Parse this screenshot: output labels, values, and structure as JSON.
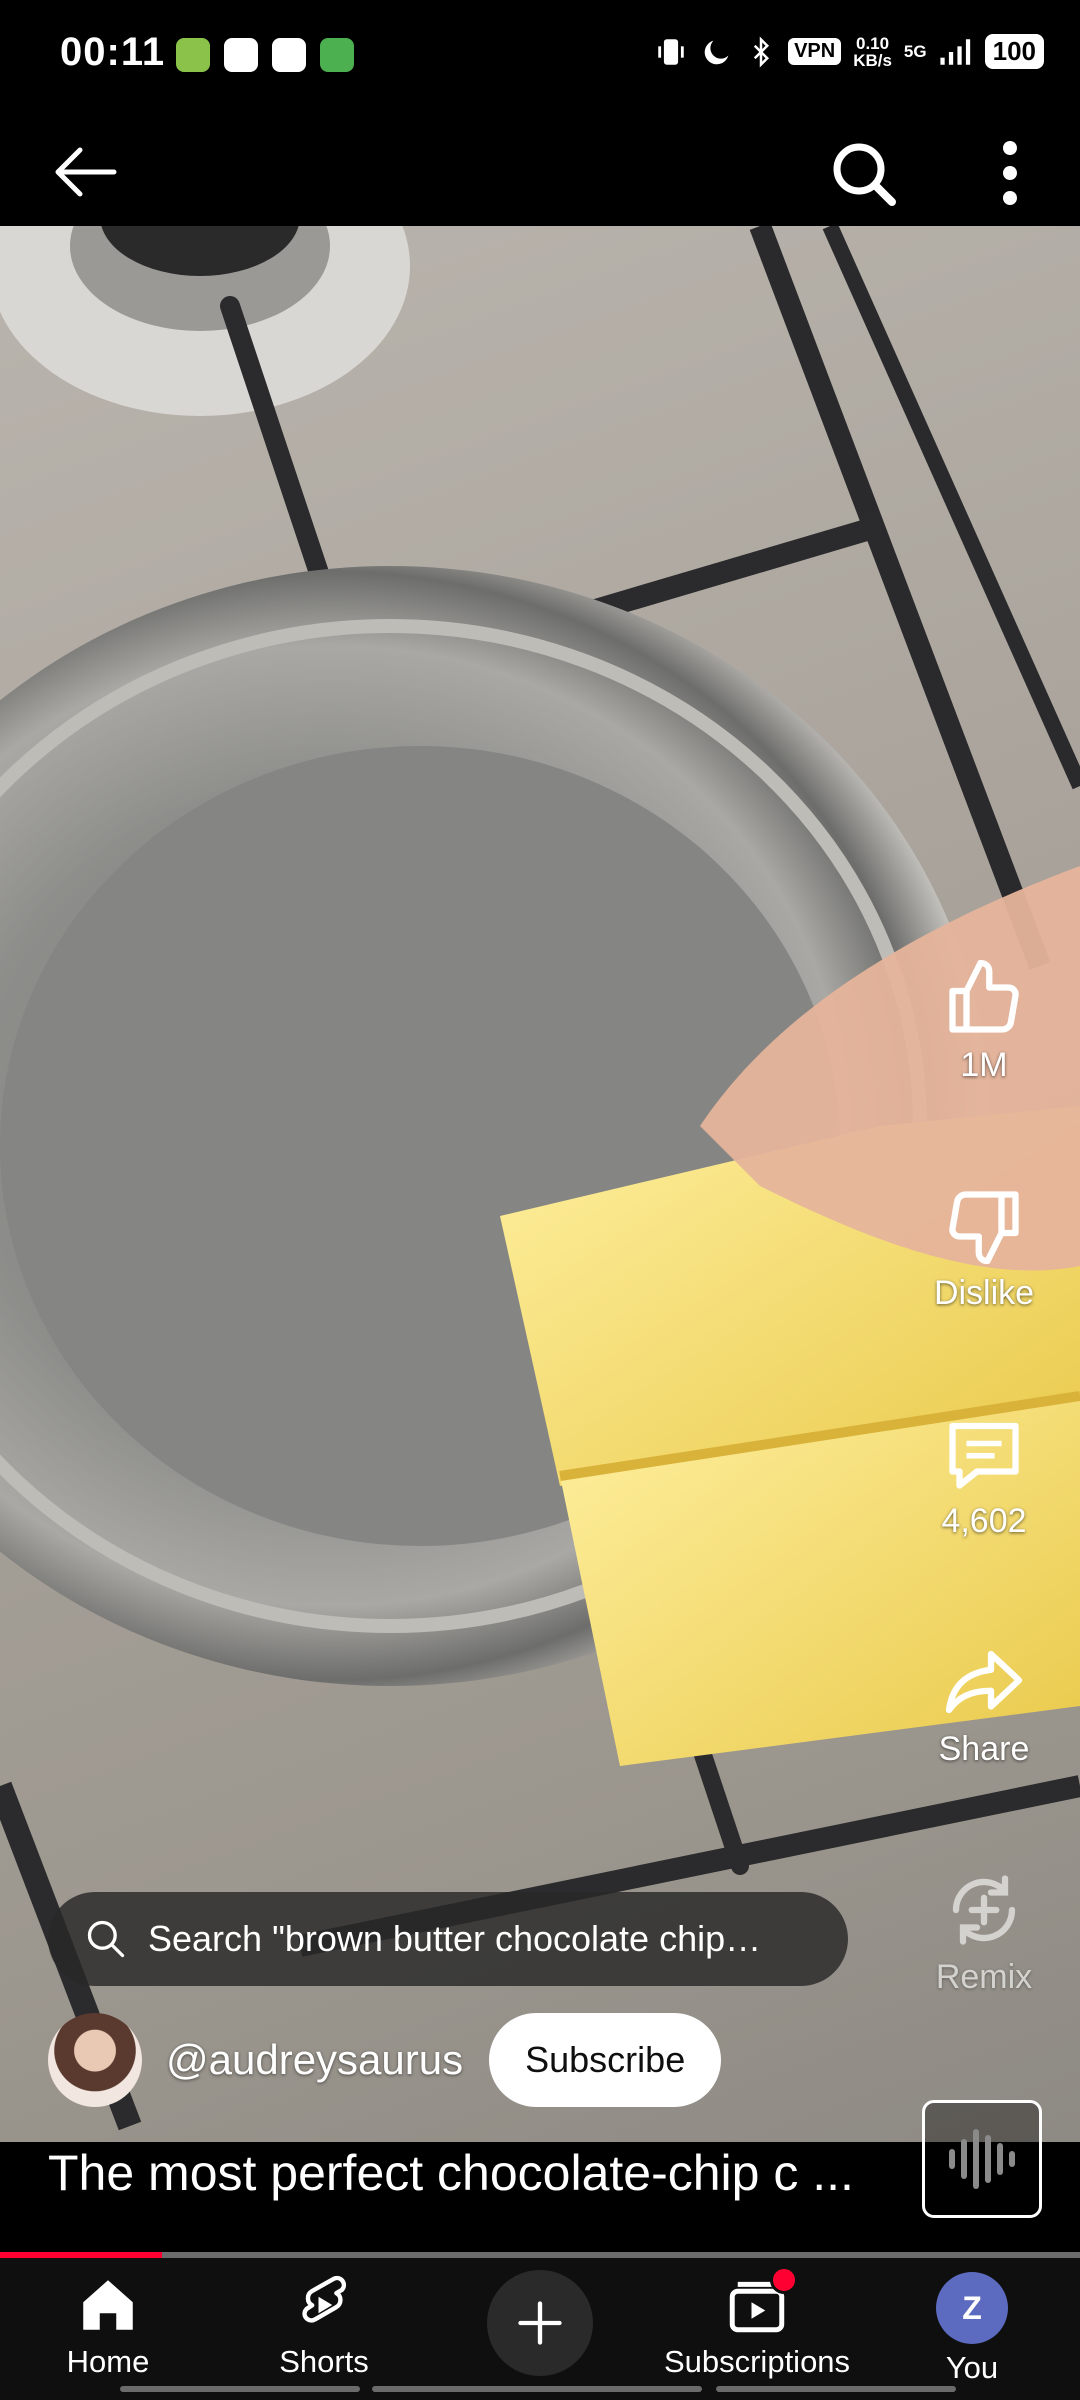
{
  "status_bar": {
    "time": "00:11",
    "vpn": "VPN",
    "net_speed_value": "0.10",
    "net_speed_unit": "KB/s",
    "network": "5G",
    "battery": "100"
  },
  "top_bar": {
    "back_icon": "arrow-left-icon",
    "search_icon": "search-icon",
    "more_icon": "more-vertical-icon"
  },
  "actions": {
    "like_count": "1M",
    "dislike_label": "Dislike",
    "comments_count": "4,602",
    "share_label": "Share",
    "remix_label": "Remix"
  },
  "search_suggestion": "Search \"brown butter chocolate chip…",
  "channel": {
    "handle": "@audreysaurus",
    "subscribe_label": "Subscribe"
  },
  "video_title": "The most perfect chocolate-chip c ...",
  "playback_progress_percent": 15,
  "bottom_nav": {
    "home": "Home",
    "shorts": "Shorts",
    "subscriptions": "Subscriptions",
    "you": "You",
    "you_initial": "Z",
    "subscriptions_badge_color": "#ff0033"
  },
  "colors": {
    "accent": "#ff0033",
    "nav_background": "#0f0f0f"
  }
}
